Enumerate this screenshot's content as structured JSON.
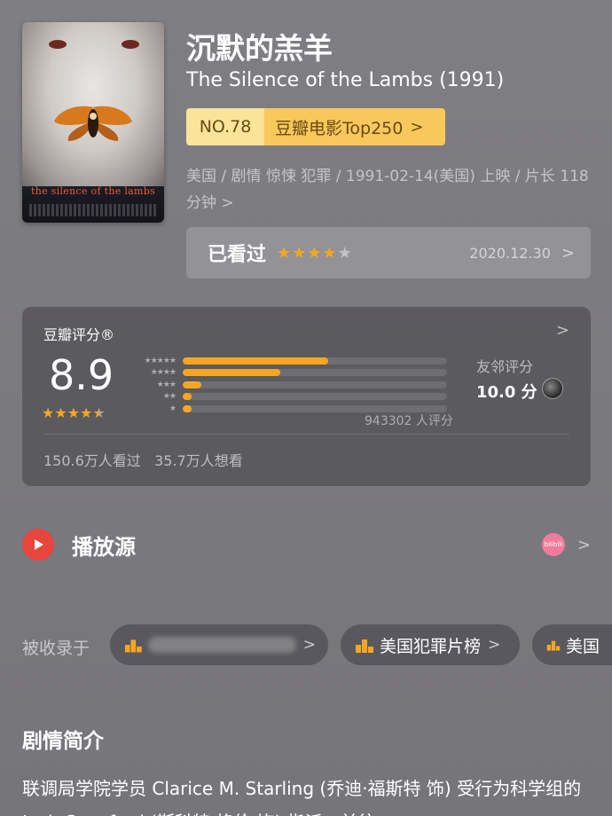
{
  "movie": {
    "title_zh": "沉默的羔羊",
    "title_en": "The Silence of the Lambs (1991)",
    "poster_title": "the silence of the lambs",
    "rank_no": "NO.78",
    "rank_list": "豆瓣电影Top250",
    "meta": "美国 / 剧情 惊悚 犯罪 / 1991-02-14(美国) 上映 / 片长 118分钟",
    "meta_chev": ">"
  },
  "seen": {
    "label": "已看过",
    "stars_on": "★★★★",
    "stars_off": "★",
    "date": "2020.12.30",
    "chevron": ">"
  },
  "rating": {
    "title": "豆瓣评分®",
    "chevron": ">",
    "score": "8.9",
    "stars_on": "★★★★",
    "stars_half": "★",
    "distribution": [
      0.55,
      0.37,
      0.07,
      0.02,
      0.02
    ],
    "star_rows": [
      "★★★★★",
      "★★★★",
      "★★★",
      "★★",
      "★"
    ],
    "votes": "943302 人评分",
    "friend_label": "友邻评分",
    "friend_score": "10.0 分",
    "watched": "150.6万人看过",
    "wish": "35.7万人想看"
  },
  "play": {
    "label": "播放源",
    "source_icon_text": "bilibili",
    "chevron": ">"
  },
  "collections": {
    "label": "被收录于",
    "items": [
      "",
      "美国犯罪片榜",
      "美国"
    ],
    "chevron": ">"
  },
  "synopsis": {
    "title": "剧情简介",
    "text": "联调局学院学员 Clarice M. Starling (乔迪·福斯特 饰) 受行为科学组的 Jack Crawford (斯科特·格伦 饰) 指派，前往"
  },
  "colors": {
    "accent": "#f6a623",
    "rank_no_bg": "#fbe49a",
    "rank_label_bg": "#f9c85c",
    "play_red": "#e8453c"
  }
}
